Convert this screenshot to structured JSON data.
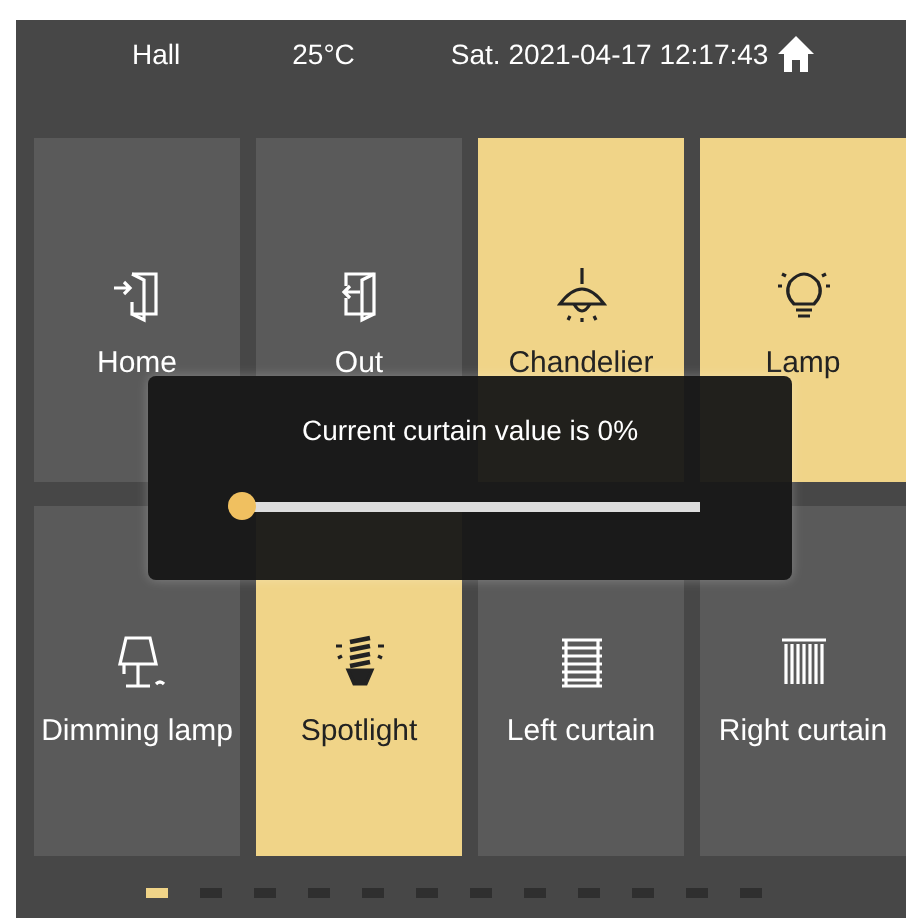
{
  "header": {
    "room": "Hall",
    "temperature": "25°C",
    "datetime": "Sat. 2021-04-17 12:17:43"
  },
  "tiles": [
    {
      "label": "Home",
      "kind": "door-in",
      "on": false
    },
    {
      "label": "Out",
      "kind": "door-out",
      "on": false
    },
    {
      "label": "Chandelier",
      "kind": "pendant",
      "on": true
    },
    {
      "label": "Lamp",
      "kind": "bulb",
      "on": true
    },
    {
      "label": "Dimming lamp",
      "kind": "table-lamp",
      "on": false
    },
    {
      "label": "Spotlight",
      "kind": "spiral-bulb",
      "on": true
    },
    {
      "label": "Left curtain",
      "kind": "blinds",
      "on": false
    },
    {
      "label": "Right curtain",
      "kind": "vertical-blinds",
      "on": false
    }
  ],
  "dialog": {
    "message": "Current curtain value is 0%",
    "level": 0
  },
  "pages": [
    {
      "selected": true
    },
    {
      "selected": false
    },
    {
      "selected": false
    },
    {
      "selected": false
    },
    {
      "selected": false
    },
    {
      "selected": false
    },
    {
      "selected": false
    },
    {
      "selected": false
    },
    {
      "selected": false
    },
    {
      "selected": false
    },
    {
      "selected": false
    },
    {
      "selected": false
    }
  ]
}
